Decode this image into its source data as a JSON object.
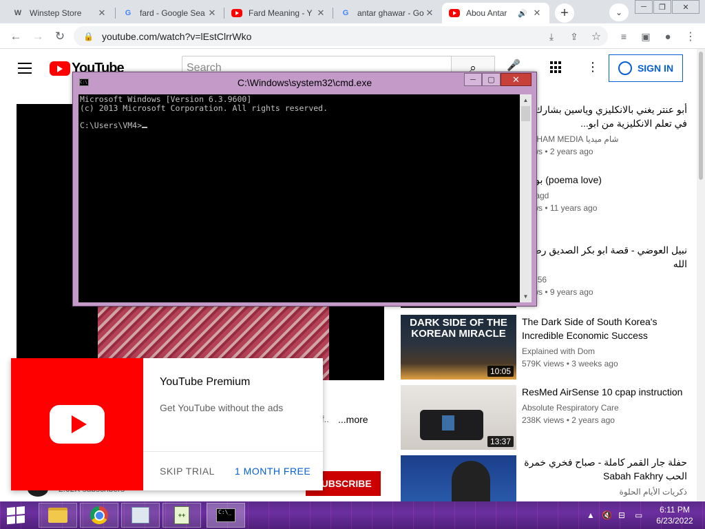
{
  "browser": {
    "tabs": [
      {
        "title": "Winstep Store",
        "icon": "winstep-icon",
        "active": false
      },
      {
        "title": "fard - Google Sea",
        "icon": "google-icon",
        "active": false
      },
      {
        "title": "Fard Meaning - Y",
        "icon": "youtube-icon",
        "active": false
      },
      {
        "title": "antar ghawar - Go",
        "icon": "google-icon",
        "active": false
      },
      {
        "title": "Abou Antar",
        "icon": "youtube-icon",
        "active": true
      }
    ],
    "url": "youtube.com/watch?v=lEstClrrWko"
  },
  "youtube": {
    "logo_text": "YouTube",
    "search_placeholder": "Search",
    "sign_in": "SIGN IN",
    "more_label": "...more",
    "subscribers": "2.02K subscribers",
    "subscribe_label": "SUBSCRIBE",
    "recommendations": [
      {
        "title": "أبو عنتر يغني بالانكليزي وياسين بشارك في تعلم الانكليزية من ابو...",
        "channel": "شام ميديا SHAM MEDIA",
        "views": "views • 2 years ago",
        "duration": ""
      },
      {
        "title": "بوسة (poema love)",
        "channel": "elmagd",
        "views": "views • 11 years ago",
        "duration": ""
      },
      {
        "title": "نبيل العوضي - قصة ابو بكر الصديق رضي الله",
        "channel": "udi256",
        "views": "views • 9 years ago",
        "duration": ""
      },
      {
        "title": "The Dark Side of South Korea's Incredible Economic Success",
        "channel": "Explained with Dom",
        "views": "579K views • 3 weeks ago",
        "duration": "10:05",
        "thumb_text": "DARK SIDE OF THE KOREAN MIRACLE"
      },
      {
        "title": "ResMed AirSense 10 cpap instruction",
        "channel": "Absolute Respiratory Care",
        "views": "238K views • 2 years ago",
        "duration": "13:37"
      },
      {
        "title": "حفلة جار القمر كاملة - صباح فخري خمرة الحب Sabah Fakhry",
        "channel": "ذكريات الأيام الحلوة",
        "views": "",
        "duration": ""
      }
    ],
    "promo": {
      "title": "YouTube Premium",
      "subtitle": "Get YouTube without the ads",
      "skip": "SKIP TRIAL",
      "cta": "1 MONTH FREE"
    }
  },
  "cmd": {
    "title": "C:\\Windows\\system32\\cmd.exe",
    "line1": "Microsoft Windows [Version 6.3.9600]",
    "line2": "(c) 2013 Microsoft Corporation. All rights reserved.",
    "prompt": "C:\\Users\\VM4>"
  },
  "taskbar": {
    "apps": [
      "file-explorer",
      "chrome",
      "control-panel",
      "notepad-plus-plus",
      "command-prompt"
    ],
    "time": "6:11 PM",
    "date": "6/23/2022"
  },
  "colors": {
    "youtube_red": "#ff0000",
    "link_blue": "#065fd4",
    "cmd_frame": "#c49ac9",
    "taskbar": "#5a2a8a"
  }
}
